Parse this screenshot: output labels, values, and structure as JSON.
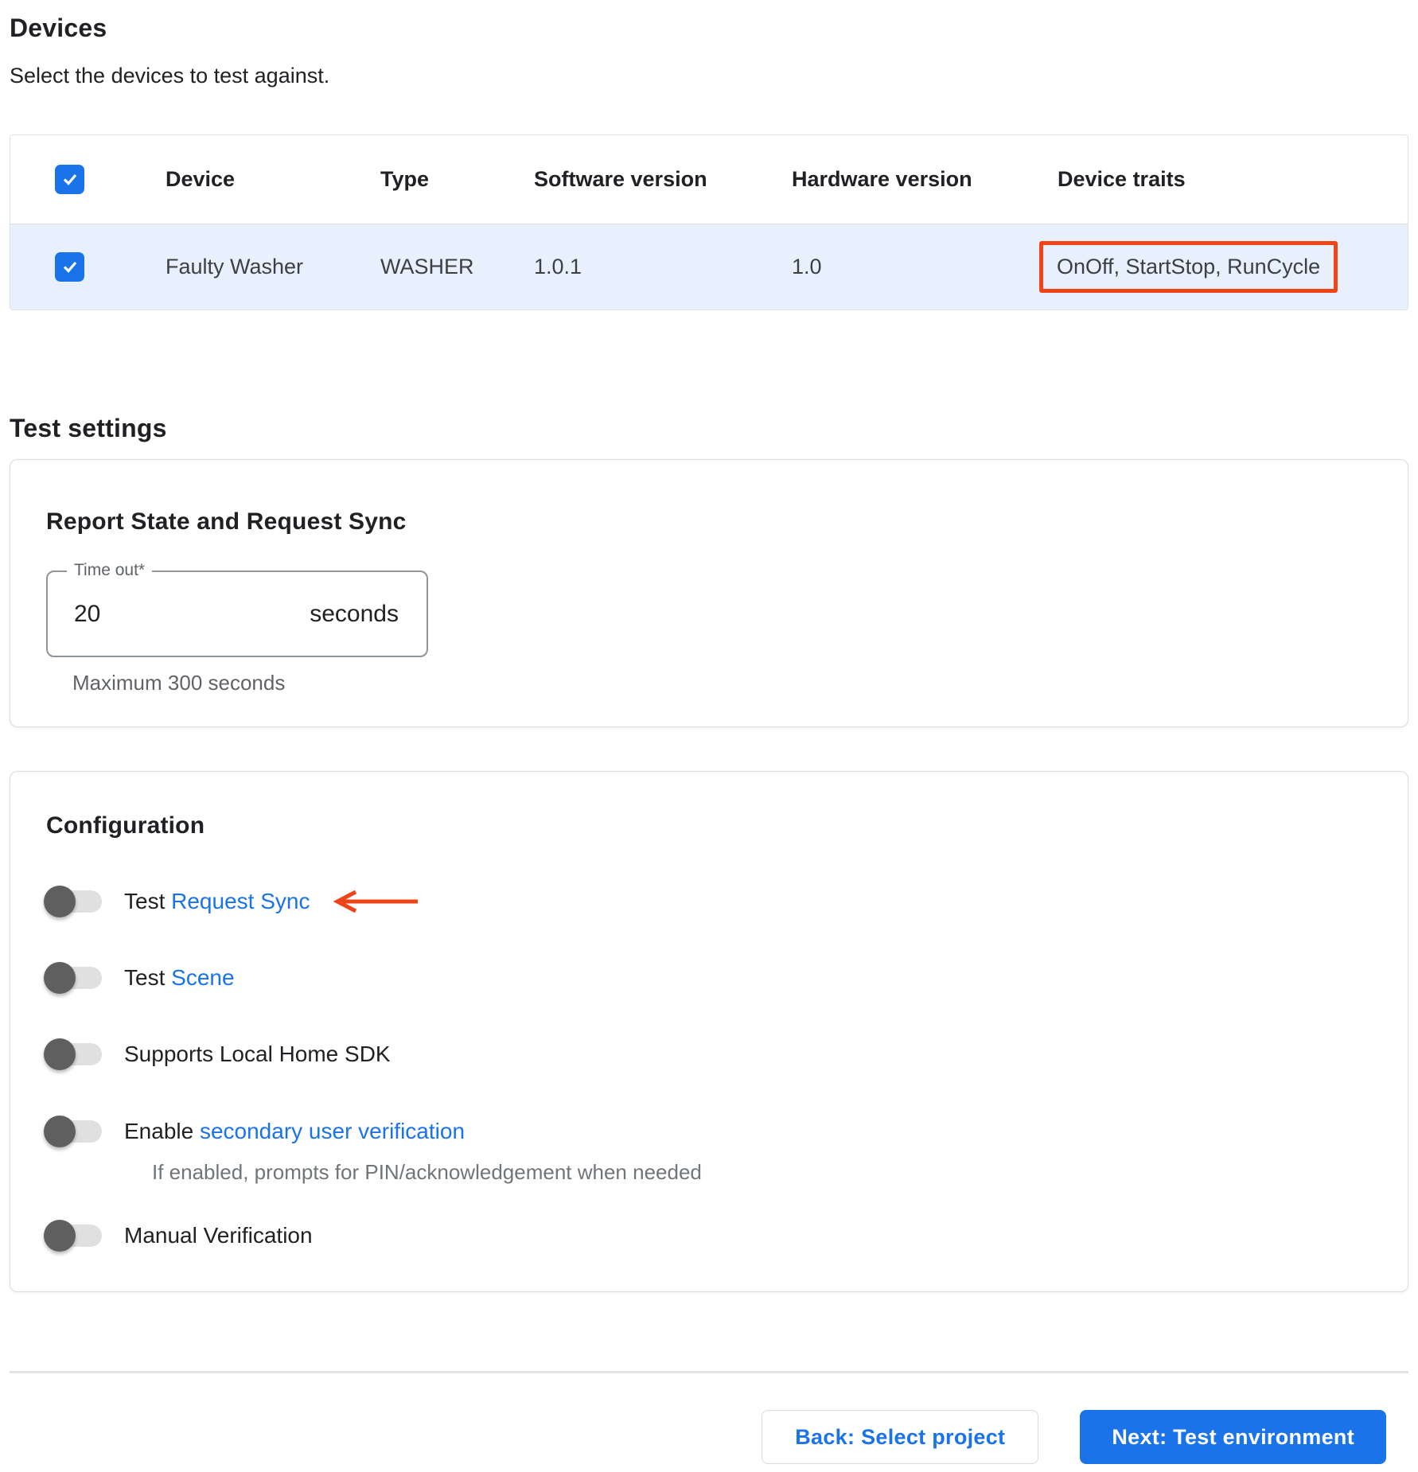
{
  "devices_section": {
    "title": "Devices",
    "subtitle": "Select the devices to test against."
  },
  "device_table": {
    "header_checkbox_checked": true,
    "headers": {
      "device": "Device",
      "type": "Type",
      "software_version": "Software version",
      "hardware_version": "Hardware version",
      "device_traits": "Device traits"
    },
    "row": {
      "selected": true,
      "device": "Faulty Washer",
      "type": "WASHER",
      "software_version": "1.0.1",
      "hardware_version": "1.0",
      "device_traits": "OnOff, StartStop, RunCycle",
      "device_traits_annotated": true
    }
  },
  "test_settings": {
    "title": "Test settings"
  },
  "report_state_card": {
    "title": "Report State and Request Sync",
    "timeout": {
      "label": "Time out*",
      "value": "20",
      "unit": "seconds",
      "helper": "Maximum 300 seconds"
    }
  },
  "configuration_card": {
    "title": "Configuration",
    "toggles": [
      {
        "prefix": "Test ",
        "link": "Request Sync",
        "state": "off",
        "annotated_with_arrow": true
      },
      {
        "prefix": "Test ",
        "link": "Scene",
        "state": "off"
      },
      {
        "prefix": "Supports Local Home SDK",
        "link": "",
        "state": "off"
      },
      {
        "prefix": "Enable ",
        "link": "secondary user verification",
        "state": "off",
        "helper": "If enabled, prompts for PIN/acknowledgement when needed"
      },
      {
        "prefix": "Manual Verification",
        "link": "",
        "state": "off"
      }
    ]
  },
  "footer": {
    "back_label": "Back: Select project",
    "next_label": "Next: Test environment"
  },
  "colors": {
    "accent_blue": "#1a73e8",
    "selected_row_bg": "#e8f0fe",
    "annotation_red": "#f04318",
    "toggle_thumb": "#5f5f5f",
    "toggle_track": "#e0e0e0"
  }
}
